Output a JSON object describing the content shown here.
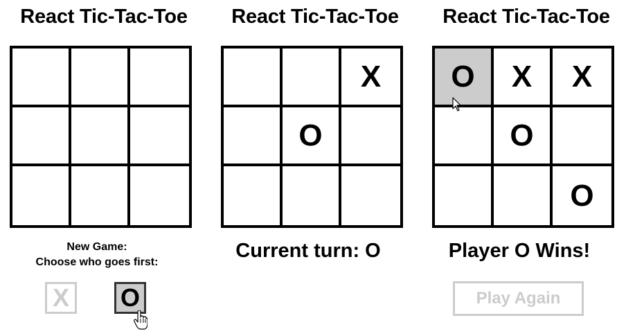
{
  "panels": [
    {
      "title": "React Tic-Tac-Toe",
      "board": [
        "",
        "",
        "",
        "",
        "",
        "",
        "",
        "",
        ""
      ],
      "new_game": {
        "line1": "New Game:",
        "line2": "Choose who goes first:",
        "option_x": "X",
        "option_o": "O",
        "selected": "O"
      }
    },
    {
      "title": "React Tic-Tac-Toe",
      "board": [
        "",
        "",
        "X",
        "",
        "O",
        "",
        "",
        "",
        ""
      ],
      "status": "Current turn: O"
    },
    {
      "title": "React Tic-Tac-Toe",
      "board": [
        "O",
        "X",
        "X",
        "",
        "O",
        "",
        "",
        "",
        "O"
      ],
      "hovered_cell": 0,
      "status": "Player O Wins!",
      "play_again_label": "Play Again"
    }
  ],
  "icons": {
    "arrow_cursor": "arrow-cursor-icon",
    "hand_cursor": "hand-pointer-cursor-icon"
  }
}
